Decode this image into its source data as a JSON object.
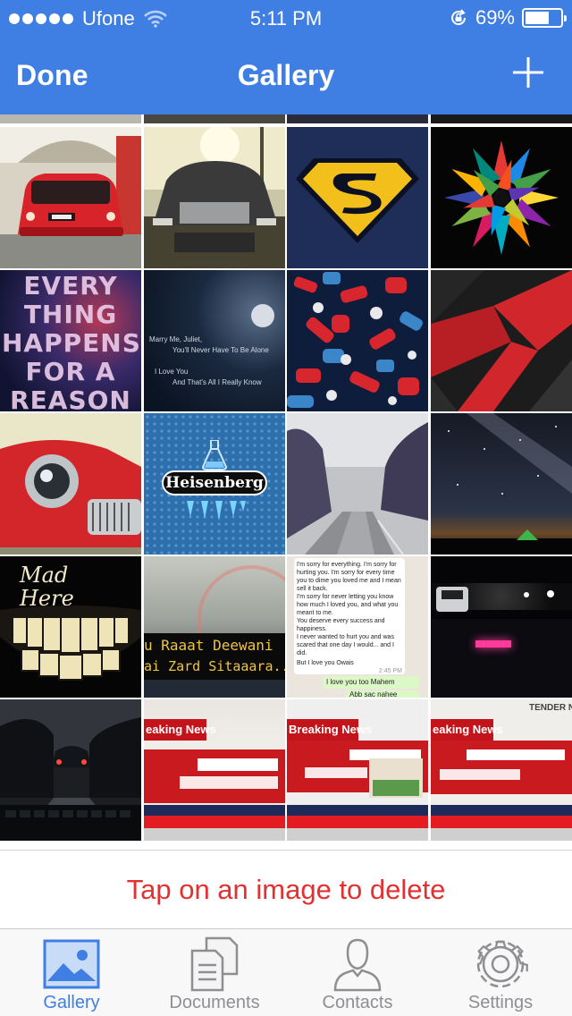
{
  "status_bar": {
    "carrier": "Ufone",
    "time": "5:11 PM",
    "battery": "69%",
    "battery_level": 0.69
  },
  "nav": {
    "left_label": "Done",
    "title": "Gallery",
    "right_icon": "plus-icon"
  },
  "gallery": {
    "tile_texts": {
      "everything": "EVERY THING HAPPENS FOR A REASON",
      "marry_line1": "Marry Me, Juliet,",
      "marry_line2": "You'll Never Have To Be Alone",
      "marry_line3": "I Love You",
      "marry_line4": "And That's All I Really Know",
      "heisenberg": "Heisenberg",
      "madhere": "Mad Here",
      "deewani1": "u Raaat Deewani",
      "deewani2": "ai Zard Sitaaara...",
      "chat1": "I'm sorry for everything. I'm sorry for hurting you. I'm sorry for every time you to dime you loved me and I mean sell it back.",
      "chat2": "I'm sorry for never letting you know how much I loved you, and what you meant to me.",
      "chat3": "You deserve every success and happiness.",
      "chat4": "I never wanted to hurt you and was scared that one day I would... and I did.",
      "chat5": "But I love you Owais",
      "chat_time": "2:45 PM",
      "chat_reply1": "I love you too Mahem",
      "chat_reply2": "Abb sac nahee",
      "news_label": "eaking News",
      "news_label2": "Breaking News",
      "news_label3": "eaking News",
      "tender": "TENDER N"
    }
  },
  "delete_hint": "Tap on an image to delete",
  "tabs": [
    {
      "label": "Gallery",
      "icon": "image-icon",
      "active": true
    },
    {
      "label": "Documents",
      "icon": "documents-icon",
      "active": false
    },
    {
      "label": "Contacts",
      "icon": "contact-icon",
      "active": false
    },
    {
      "label": "Settings",
      "icon": "gear-icon",
      "active": false
    }
  ],
  "colors": {
    "accent": "#3f7ee3",
    "delete_text": "#e33131",
    "tab_inactive": "#8e8e93"
  }
}
